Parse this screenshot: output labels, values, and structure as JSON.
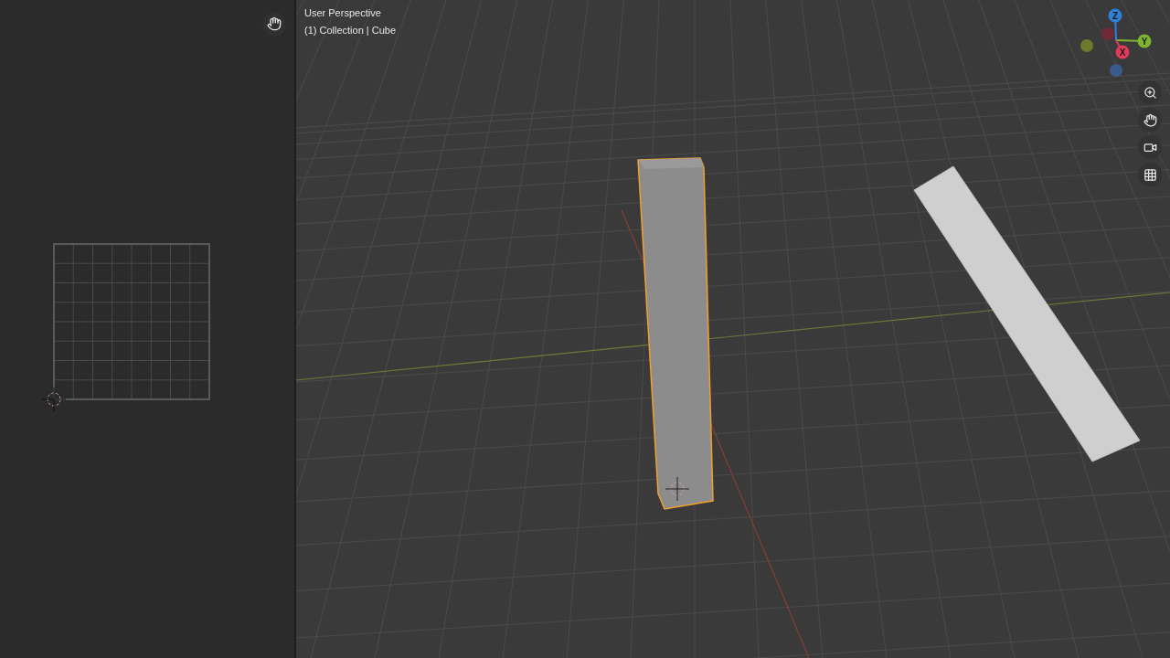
{
  "viewport": {
    "view_name": "User Perspective",
    "collection_info": "(1) Collection | Cube"
  },
  "gizmo_axes": [
    {
      "label": "Z",
      "color": "#2f7fd8",
      "kind": "positive"
    },
    {
      "label": "Y",
      "color": "#7fb52c",
      "kind": "positive"
    },
    {
      "label": "X",
      "color": "#e23a5c",
      "kind": "positive"
    },
    {
      "color": "#6f2a35",
      "kind": "negative"
    },
    {
      "color": "#6c7a2c",
      "kind": "negative"
    },
    {
      "color": "#3a5a8c",
      "kind": "negative"
    }
  ],
  "objects": [
    {
      "kind": "column",
      "selected": true
    },
    {
      "kind": "plank",
      "selected": false
    }
  ]
}
